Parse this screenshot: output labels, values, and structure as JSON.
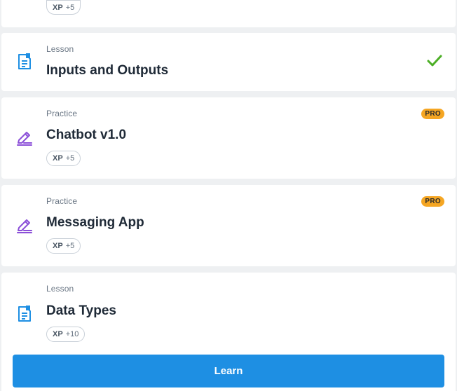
{
  "items": [
    {
      "kind": "",
      "title": "",
      "xp_label": "XP",
      "xp_value": "+5",
      "pro": false,
      "completed": false,
      "icon": "practice-pencil-icon"
    },
    {
      "kind": "Lesson",
      "title": "Inputs and Outputs",
      "completed": true,
      "icon": "lesson-document-icon"
    },
    {
      "kind": "Practice",
      "title": "Chatbot v1.0",
      "xp_label": "XP",
      "xp_value": "+5",
      "pro": true,
      "pro_label": "PRO",
      "icon": "practice-pencil-icon"
    },
    {
      "kind": "Practice",
      "title": "Messaging App",
      "xp_label": "XP",
      "xp_value": "+5",
      "pro": true,
      "pro_label": "PRO",
      "icon": "practice-pencil-icon"
    },
    {
      "kind": "Lesson",
      "title": "Data Types",
      "xp_label": "XP",
      "xp_value": "+10",
      "icon": "lesson-document-icon"
    }
  ],
  "learn_button": {
    "label": "Learn"
  },
  "colors": {
    "lesson_icon": "#1e8fe3",
    "practice_icon": "#8b4fd8",
    "check": "#4caf26",
    "pro_badge": "#f5a623",
    "button": "#1e8fe3"
  }
}
